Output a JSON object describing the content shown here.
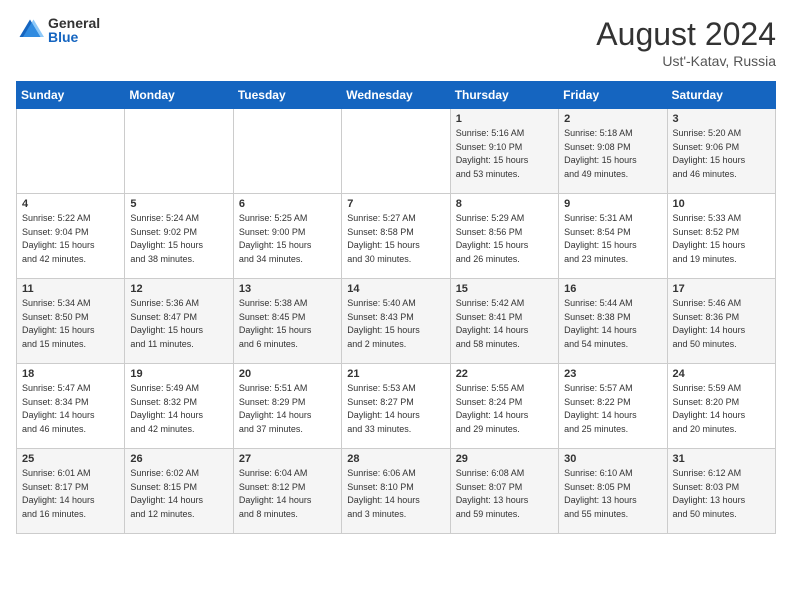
{
  "logo": {
    "general": "General",
    "blue": "Blue"
  },
  "title": {
    "month_year": "August 2024",
    "location": "Ust'-Katav, Russia"
  },
  "weekdays": [
    "Sunday",
    "Monday",
    "Tuesday",
    "Wednesday",
    "Thursday",
    "Friday",
    "Saturday"
  ],
  "weeks": [
    [
      {
        "day": "",
        "info": ""
      },
      {
        "day": "",
        "info": ""
      },
      {
        "day": "",
        "info": ""
      },
      {
        "day": "",
        "info": ""
      },
      {
        "day": "1",
        "info": "Sunrise: 5:16 AM\nSunset: 9:10 PM\nDaylight: 15 hours\nand 53 minutes."
      },
      {
        "day": "2",
        "info": "Sunrise: 5:18 AM\nSunset: 9:08 PM\nDaylight: 15 hours\nand 49 minutes."
      },
      {
        "day": "3",
        "info": "Sunrise: 5:20 AM\nSunset: 9:06 PM\nDaylight: 15 hours\nand 46 minutes."
      }
    ],
    [
      {
        "day": "4",
        "info": "Sunrise: 5:22 AM\nSunset: 9:04 PM\nDaylight: 15 hours\nand 42 minutes."
      },
      {
        "day": "5",
        "info": "Sunrise: 5:24 AM\nSunset: 9:02 PM\nDaylight: 15 hours\nand 38 minutes."
      },
      {
        "day": "6",
        "info": "Sunrise: 5:25 AM\nSunset: 9:00 PM\nDaylight: 15 hours\nand 34 minutes."
      },
      {
        "day": "7",
        "info": "Sunrise: 5:27 AM\nSunset: 8:58 PM\nDaylight: 15 hours\nand 30 minutes."
      },
      {
        "day": "8",
        "info": "Sunrise: 5:29 AM\nSunset: 8:56 PM\nDaylight: 15 hours\nand 26 minutes."
      },
      {
        "day": "9",
        "info": "Sunrise: 5:31 AM\nSunset: 8:54 PM\nDaylight: 15 hours\nand 23 minutes."
      },
      {
        "day": "10",
        "info": "Sunrise: 5:33 AM\nSunset: 8:52 PM\nDaylight: 15 hours\nand 19 minutes."
      }
    ],
    [
      {
        "day": "11",
        "info": "Sunrise: 5:34 AM\nSunset: 8:50 PM\nDaylight: 15 hours\nand 15 minutes."
      },
      {
        "day": "12",
        "info": "Sunrise: 5:36 AM\nSunset: 8:47 PM\nDaylight: 15 hours\nand 11 minutes."
      },
      {
        "day": "13",
        "info": "Sunrise: 5:38 AM\nSunset: 8:45 PM\nDaylight: 15 hours\nand 6 minutes."
      },
      {
        "day": "14",
        "info": "Sunrise: 5:40 AM\nSunset: 8:43 PM\nDaylight: 15 hours\nand 2 minutes."
      },
      {
        "day": "15",
        "info": "Sunrise: 5:42 AM\nSunset: 8:41 PM\nDaylight: 14 hours\nand 58 minutes."
      },
      {
        "day": "16",
        "info": "Sunrise: 5:44 AM\nSunset: 8:38 PM\nDaylight: 14 hours\nand 54 minutes."
      },
      {
        "day": "17",
        "info": "Sunrise: 5:46 AM\nSunset: 8:36 PM\nDaylight: 14 hours\nand 50 minutes."
      }
    ],
    [
      {
        "day": "18",
        "info": "Sunrise: 5:47 AM\nSunset: 8:34 PM\nDaylight: 14 hours\nand 46 minutes."
      },
      {
        "day": "19",
        "info": "Sunrise: 5:49 AM\nSunset: 8:32 PM\nDaylight: 14 hours\nand 42 minutes."
      },
      {
        "day": "20",
        "info": "Sunrise: 5:51 AM\nSunset: 8:29 PM\nDaylight: 14 hours\nand 37 minutes."
      },
      {
        "day": "21",
        "info": "Sunrise: 5:53 AM\nSunset: 8:27 PM\nDaylight: 14 hours\nand 33 minutes."
      },
      {
        "day": "22",
        "info": "Sunrise: 5:55 AM\nSunset: 8:24 PM\nDaylight: 14 hours\nand 29 minutes."
      },
      {
        "day": "23",
        "info": "Sunrise: 5:57 AM\nSunset: 8:22 PM\nDaylight: 14 hours\nand 25 minutes."
      },
      {
        "day": "24",
        "info": "Sunrise: 5:59 AM\nSunset: 8:20 PM\nDaylight: 14 hours\nand 20 minutes."
      }
    ],
    [
      {
        "day": "25",
        "info": "Sunrise: 6:01 AM\nSunset: 8:17 PM\nDaylight: 14 hours\nand 16 minutes."
      },
      {
        "day": "26",
        "info": "Sunrise: 6:02 AM\nSunset: 8:15 PM\nDaylight: 14 hours\nand 12 minutes."
      },
      {
        "day": "27",
        "info": "Sunrise: 6:04 AM\nSunset: 8:12 PM\nDaylight: 14 hours\nand 8 minutes."
      },
      {
        "day": "28",
        "info": "Sunrise: 6:06 AM\nSunset: 8:10 PM\nDaylight: 14 hours\nand 3 minutes."
      },
      {
        "day": "29",
        "info": "Sunrise: 6:08 AM\nSunset: 8:07 PM\nDaylight: 13 hours\nand 59 minutes."
      },
      {
        "day": "30",
        "info": "Sunrise: 6:10 AM\nSunset: 8:05 PM\nDaylight: 13 hours\nand 55 minutes."
      },
      {
        "day": "31",
        "info": "Sunrise: 6:12 AM\nSunset: 8:03 PM\nDaylight: 13 hours\nand 50 minutes."
      }
    ]
  ]
}
